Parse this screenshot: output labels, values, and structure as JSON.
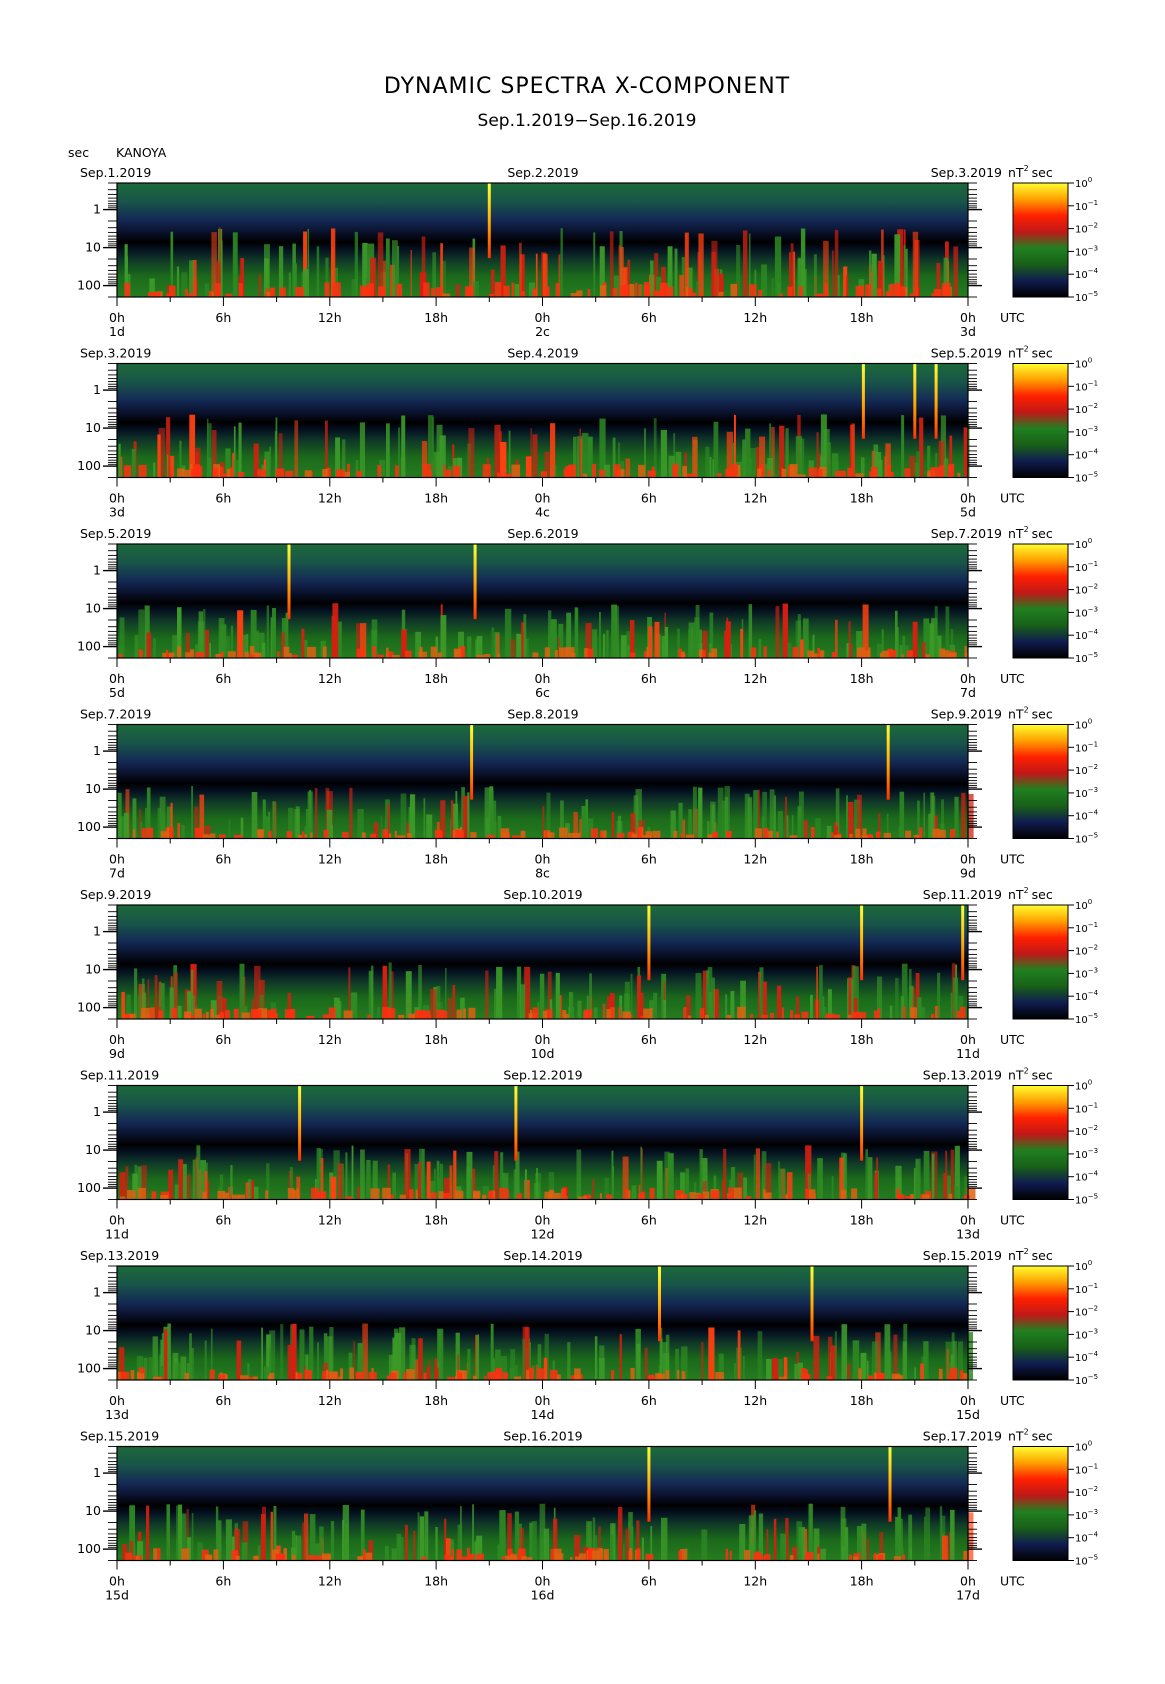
{
  "title": "DYNAMIC SPECTRA X-COMPONENT",
  "subtitle": "Sep.1.2019−Sep.16.2019",
  "y_unit": "sec",
  "station": "KANOYA",
  "colorbar_unit_label": "nT",
  "colorbar_unit_exp": "2",
  "colorbar_unit_suffix": "sec",
  "utc_label": "UTC",
  "chart_data": {
    "type": "heatmap",
    "x_label": "UTC",
    "y_label": "sec",
    "y_scale": "log",
    "y_ticks": [
      "1",
      "10",
      "100"
    ],
    "y_range_sec": [
      0.2,
      200
    ],
    "x_ticks": [
      "0h",
      "6h",
      "12h",
      "18h",
      "0h",
      "6h",
      "12h",
      "18h",
      "0h"
    ],
    "colorbar_ticks": [
      "10",
      "10",
      "10",
      "10",
      "10",
      "10"
    ],
    "colorbar_exponents": [
      "0",
      "−1",
      "−2",
      "−3",
      "−4",
      "−5"
    ],
    "colorscale": [
      "#ffff30",
      "#ffa000",
      "#ff2000",
      "#c01818",
      "#208020",
      "#186018",
      "#101c50",
      "#000000"
    ],
    "panels": [
      {
        "left_date": "Sep.1.2019",
        "mid_date": "Sep.2.2019",
        "right_date": "Sep.3.2019",
        "day_labels": [
          "1d",
          "2c",
          "3d"
        ],
        "spikes_hours": [
          21.0
        ],
        "activity": 0.85
      },
      {
        "left_date": "Sep.3.2019",
        "mid_date": "Sep.4.2019",
        "right_date": "Sep.5.2019",
        "day_labels": [
          "3d",
          "4c",
          "5d"
        ],
        "spikes_hours": [
          42.1,
          45.0,
          46.2
        ],
        "activity": 0.7
      },
      {
        "left_date": "Sep.5.2019",
        "mid_date": "Sep.6.2019",
        "right_date": "Sep.7.2019",
        "day_labels": [
          "5d",
          "6c",
          "7d"
        ],
        "spikes_hours": [
          9.7,
          20.2
        ],
        "activity": 0.5
      },
      {
        "left_date": "Sep.7.2019",
        "mid_date": "Sep.8.2019",
        "right_date": "Sep.9.2019",
        "day_labels": [
          "7d",
          "8c",
          "9d"
        ],
        "spikes_hours": [
          20.0,
          43.5
        ],
        "activity": 0.45
      },
      {
        "left_date": "Sep.9.2019",
        "mid_date": "Sep.10.2019",
        "right_date": "Sep.11.2019",
        "day_labels": [
          "9d",
          "10d",
          "11d"
        ],
        "spikes_hours": [
          30.0,
          42.0,
          47.7
        ],
        "activity": 0.55
      },
      {
        "left_date": "Sep.11.2019",
        "mid_date": "Sep.12.2019",
        "right_date": "Sep.13.2019",
        "day_labels": [
          "11d",
          "12d",
          "13d"
        ],
        "spikes_hours": [
          10.3,
          22.5,
          42.0
        ],
        "activity": 0.5
      },
      {
        "left_date": "Sep.13.2019",
        "mid_date": "Sep.14.2019",
        "right_date": "Sep.15.2019",
        "day_labels": [
          "13d",
          "14d",
          "15d"
        ],
        "spikes_hours": [
          30.6,
          39.2
        ],
        "activity": 0.55
      },
      {
        "left_date": "Sep.15.2019",
        "mid_date": "Sep.16.2019",
        "right_date": "Sep.17.2019",
        "day_labels": [
          "15d",
          "16d",
          "17d"
        ],
        "spikes_hours": [
          30.0,
          43.6
        ],
        "activity": 0.55
      }
    ]
  }
}
